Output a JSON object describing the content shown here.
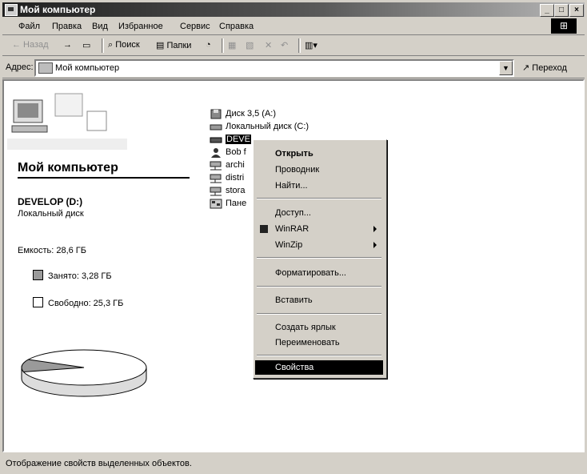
{
  "window": {
    "title": "Мой компьютер",
    "controls": [
      "_",
      "□",
      "×"
    ]
  },
  "menu": [
    "Файл",
    "Правка",
    "Вид",
    "Избранное",
    "Сервис",
    "Справка"
  ],
  "toolbar": {
    "back": "← Назад",
    "forward": "→",
    "search": "Поиск",
    "folders": "Папки"
  },
  "address": {
    "label": "Адрес:",
    "value": "Мой компьютер",
    "go": "Переход"
  },
  "left_panel": {
    "title": "Мой компьютер",
    "drive_name": "DEVELOP (D:)",
    "drive_type": "Локальный диск",
    "capacity": "Емкость: 28,6 ГБ",
    "used": "Занято: 3,28 ГБ",
    "free": "Свободно: 25,3 ГБ",
    "used_fraction": 0.115
  },
  "files": [
    {
      "label": "Диск 3,5 (A:)",
      "icon": "floppy-icon"
    },
    {
      "label": "Локальный диск (C:)",
      "icon": "drive-icon"
    },
    {
      "label": "DEVE",
      "icon": "drive-icon",
      "selected": true
    },
    {
      "label": "Bob f",
      "icon": "user-icon"
    },
    {
      "label": "archi",
      "icon": "network-drive-icon"
    },
    {
      "label": "distri",
      "icon": "network-drive-icon"
    },
    {
      "label": "stora",
      "icon": "network-drive-icon"
    },
    {
      "label": "Пане",
      "icon": "control-panel-icon"
    }
  ],
  "context_menu": {
    "open": "Открыть",
    "explorer": "Проводник",
    "find": "Найти...",
    "access": "Доступ...",
    "winrar": "WinRAR",
    "winzip": "WinZip",
    "format": "Форматировать...",
    "paste": "Вставить",
    "shortcut": "Создать ярлык",
    "rename": "Переименовать",
    "properties": "Свойства"
  },
  "status": "Отображение свойств выделенных объектов."
}
